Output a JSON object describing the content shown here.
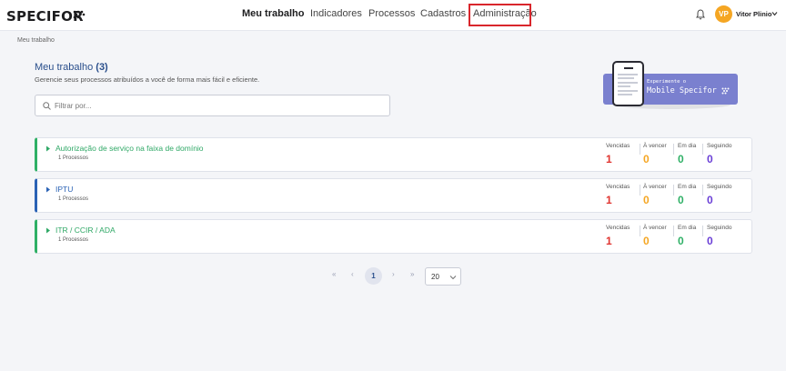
{
  "brand": {
    "logo": "SPECIFOR"
  },
  "nav": {
    "items": [
      {
        "label": "Meu trabalho"
      },
      {
        "label": "Indicadores"
      },
      {
        "label": "Processos"
      },
      {
        "label": "Cadastros"
      },
      {
        "label": "Administração"
      }
    ],
    "active": "Meu trabalho",
    "highlighted": "Administração",
    "highlight_color": "#d9262c"
  },
  "user": {
    "initials": "VP",
    "name": "Vitor Plinio",
    "avatar_color": "#f5a623",
    "notification_icon": "bell-icon"
  },
  "breadcrumb": "Meu trabalho",
  "page": {
    "title": "Meu trabalho",
    "count": "(3)",
    "subtitle": "Gerencie seus processos atribuídos a você de forma mais fácil e eficiente."
  },
  "search": {
    "placeholder": "Filtrar por...",
    "value": "",
    "icon": "search-icon"
  },
  "promo": {
    "line1": "Experimente o",
    "line2": "Mobile Specifor",
    "color": "#7a80cf"
  },
  "stat_labels": {
    "vencidas": "Vencidas",
    "a_vencer": "À vencer",
    "em_dia": "Em dia",
    "seguindo": "Seguindo"
  },
  "stat_colors": {
    "vencidas": "#e0342f",
    "a_vencer": "#f5a623",
    "em_dia": "#2fb066",
    "seguindo": "#6a3fd6"
  },
  "processes": [
    {
      "name": "Autorização de serviço na faixa de domínio",
      "count_label": "1 Processos",
      "color": "#2fb066",
      "vencidas": "1",
      "a_vencer": "0",
      "em_dia": "0",
      "seguindo": "0"
    },
    {
      "name": "IPTU",
      "count_label": "1 Processos",
      "color": "#2a62b5",
      "vencidas": "1",
      "a_vencer": "0",
      "em_dia": "0",
      "seguindo": "0"
    },
    {
      "name": "ITR / CCIR / ADA",
      "count_label": "1 Processos",
      "color": "#2fb066",
      "vencidas": "1",
      "a_vencer": "0",
      "em_dia": "0",
      "seguindo": "0"
    }
  ],
  "pagination": {
    "first": "«",
    "prev": "‹",
    "current": "1",
    "next": "›",
    "last": "»",
    "page_size": "20"
  }
}
